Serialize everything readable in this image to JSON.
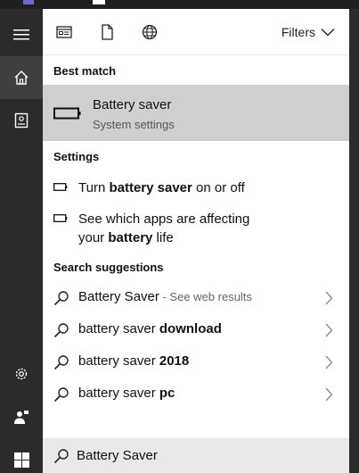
{
  "toolbar": {
    "icons": [
      "apps-icon",
      "document-icon",
      "globe-icon"
    ],
    "filters_label": "Filters"
  },
  "sections": {
    "best_match": "Best match",
    "settings": "Settings",
    "search_suggestions": "Search suggestions"
  },
  "best_match": {
    "title": "Battery saver",
    "subtitle": "System settings"
  },
  "settings_items": [
    {
      "pre": "Turn ",
      "bold": "battery saver",
      "post": " on or off"
    },
    {
      "line1": "See which apps are affecting",
      "pre2": "your ",
      "bold": "battery",
      "post2": " life"
    }
  ],
  "suggestions": [
    {
      "text": "Battery Saver",
      "bold": "",
      "hint": " - See web results"
    },
    {
      "text": "battery saver ",
      "bold": "download",
      "hint": ""
    },
    {
      "text": "battery saver ",
      "bold": "2018",
      "hint": ""
    },
    {
      "text": "battery saver ",
      "bold": "pc",
      "hint": ""
    }
  ],
  "search": {
    "value": "Battery Saver"
  },
  "rail": {
    "icons": [
      "hamburger-icon",
      "home-icon",
      "notebook-icon",
      "settings-gear-icon",
      "feedback-icon",
      "windows-start-icon"
    ]
  },
  "colors": {
    "rail_bg": "#2b2b2b",
    "selected_bg": "#cfcfcf",
    "searchbox_bg": "#e9e9e9"
  }
}
